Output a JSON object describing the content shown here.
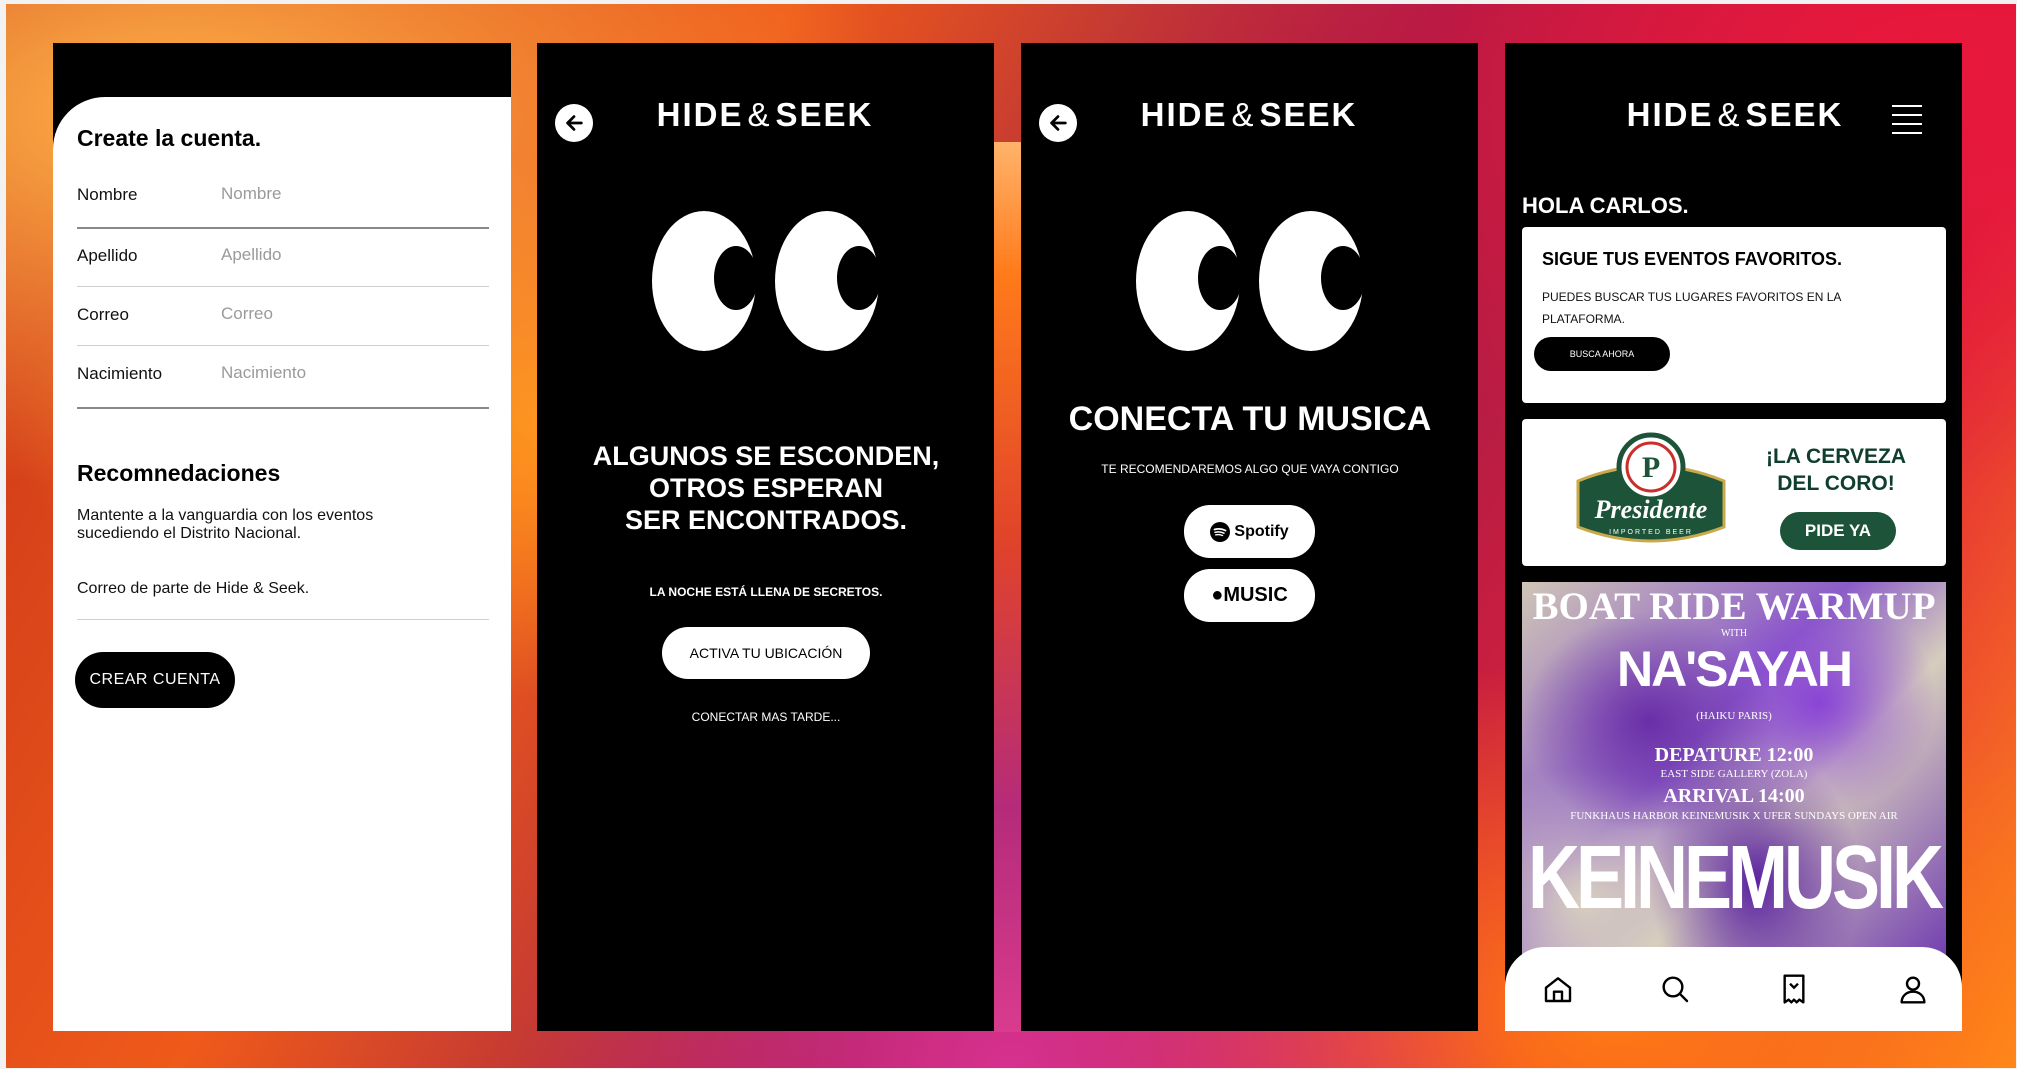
{
  "screen1": {
    "title": "Create la cuenta.",
    "fields": [
      {
        "label": "Nombre",
        "placeholder": "Nombre"
      },
      {
        "label": "Apellido",
        "placeholder": "Apellido"
      },
      {
        "label": "Correo",
        "placeholder": "Correo"
      },
      {
        "label": "Nacimiento",
        "placeholder": "Nacimiento"
      }
    ],
    "section_title": "Recomnedaciones",
    "description": "Mantente a la vanguardia con los eventos sucediendo el Distrito Nacional.",
    "mail_option": "Correo de parte de Hide & Seek.",
    "create_button": "CREAR CUENTA"
  },
  "brand": {
    "logo_left": "HIDE",
    "logo_amp": "&",
    "logo_right": "SEEK"
  },
  "screen2": {
    "headline_1": "ALGUNOS SE ESCONDEN,",
    "headline_2": "OTROS ESPERAN",
    "headline_3": "SER ENCONTRADOS.",
    "subtitle": "LA NOCHE ESTÁ LLENA DE SECRETOS.",
    "location_button": "ACTIVA TU UBICACIÓN",
    "later_link": "CONECTAR MAS TARDE..."
  },
  "screen3": {
    "headline": "CONECTA TU MUSICA",
    "subtitle": "TE RECOMENDAREMOS ALGO QUE VAYA CONTIGO",
    "spotify_button": "Spotify",
    "apple_button": "MUSIC"
  },
  "screen4": {
    "greeting": "HOLA CARLOS.",
    "card_title": "SIGUE TUS EVENTOS FAVORITOS.",
    "card_desc": "PUEDES BUSCAR TUS LUGARES FAVORITOS EN LA PLATAFORMA.",
    "card_button": "BUSCA AHORA",
    "promo_brand": "Presidente",
    "promo_brand_sub": "IMPORTED BEER",
    "promo_title_1": "¡LA CERVEZA",
    "promo_title_2": "DEL CORO!",
    "promo_button": "PIDE YA",
    "event": {
      "title": "BOAT RIDE WARMUP",
      "with": "WITH",
      "artist": "NA'SAYAH",
      "origin": "(HAIKU PARIS)",
      "departure": "DEPATURE 12:00",
      "departure_place": "EAST SIDE GALLERY (ZOLA)",
      "arrival": "ARRIVAL 14:00",
      "arrival_place": "FUNKHAUS HARBOR KEINEMUSIK X UFER SUNDAYS OPEN AIR",
      "label": "KEINEMUSIK"
    },
    "nav": [
      "home-icon",
      "search-icon",
      "bookmark-icon",
      "profile-icon"
    ]
  },
  "colors": {
    "black": "#000000",
    "white": "#ffffff",
    "presidente_green": "#1d5439",
    "spotify_green": "#1db954"
  }
}
